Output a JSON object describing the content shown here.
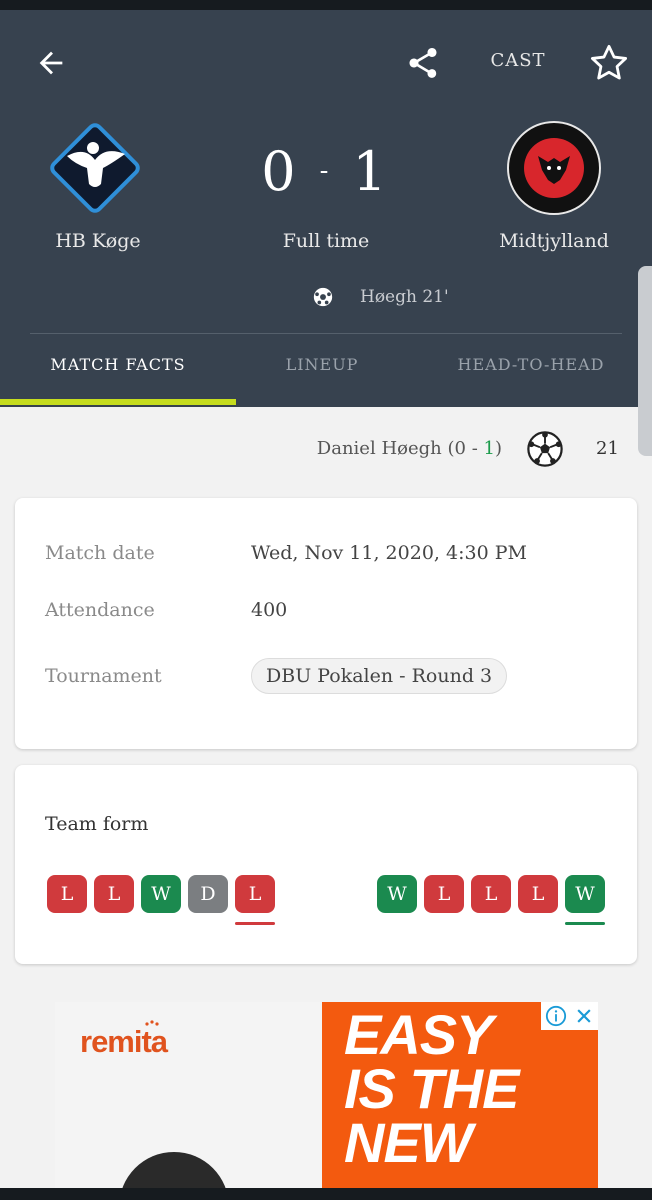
{
  "toolbar": {
    "cast_label": "CAST",
    "icons": [
      "back-arrow-icon",
      "share-icon",
      "star-icon"
    ]
  },
  "match": {
    "home_team": "HB Køge",
    "away_team": "Midtjylland",
    "home_score": "0",
    "score_separator": "-",
    "away_score": "1",
    "status": "Full time",
    "scorer_summary": "Høegh 21'"
  },
  "tabs": [
    {
      "label": "MATCH FACTS",
      "active": true
    },
    {
      "label": "LINEUP",
      "active": false
    },
    {
      "label": "HEAD-TO-HEAD",
      "active": false
    }
  ],
  "goal_event": {
    "player": "Daniel Høegh",
    "score_home": "0",
    "score_sep": "-",
    "score_away": "1",
    "minute": "21"
  },
  "info": {
    "date_label": "Match date",
    "date_value": "Wed, Nov 11, 2020, 4:30 PM",
    "attendance_label": "Attendance",
    "attendance_value": "400",
    "tournament_label": "Tournament",
    "tournament_value": "DBU Pokalen - Round 3"
  },
  "team_form": {
    "title": "Team form",
    "home": [
      "L",
      "L",
      "W",
      "D",
      "L"
    ],
    "away": [
      "W",
      "L",
      "L",
      "L",
      "W"
    ]
  },
  "ad": {
    "brand": "remita",
    "headline_line1": "EASY",
    "headline_line2": "IS THE",
    "headline_line3": "NEW"
  },
  "colors": {
    "header_bg": "#37424f",
    "tab_indicator": "#c6dd1f",
    "loss": "#d03a3d",
    "win": "#1b8a4f",
    "draw": "#7b7e81",
    "ad_orange": "#f35a0f"
  }
}
